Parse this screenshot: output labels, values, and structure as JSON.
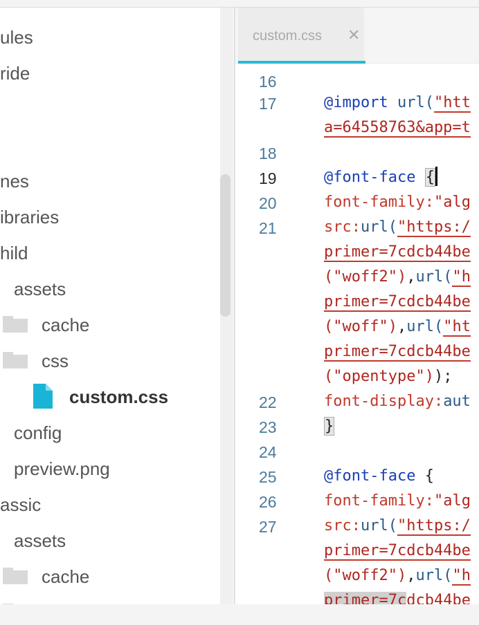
{
  "sidebar": {
    "items": [
      {
        "label": "ules"
      },
      {
        "label": "ride"
      },
      {
        "label": "nes"
      },
      {
        "label": "ibraries"
      },
      {
        "label": "hild"
      },
      {
        "label": "assets"
      },
      {
        "label": "cache"
      },
      {
        "label": "css"
      },
      {
        "label": "custom.css"
      },
      {
        "label": "config"
      },
      {
        "label": "preview.png"
      },
      {
        "label": "assic"
      },
      {
        "label": "assets"
      },
      {
        "label": "cache"
      }
    ]
  },
  "editor": {
    "tab": {
      "label": "custom.css",
      "close": "✕"
    },
    "line_numbers": [
      "16",
      "17",
      "18",
      "19",
      "20",
      "21",
      "22",
      "23",
      "24",
      "25",
      "26",
      "27"
    ],
    "lines": {
      "l17a_kw": "@import",
      "l17a_fn": "url(",
      "l17a_str": "\"htt",
      "l17b": "a=64558763&app=t",
      "l19_kw": "@font-face",
      "l19_brace": "{",
      "l20_prop": "font-family:",
      "l20_str": "\"alg",
      "l21a_prop": "src:",
      "l21a_fn": "url(",
      "l21a_str": "\"https:/",
      "l21b": "primer=7cdcb44be",
      "l21c_str1": "(\"woff2\")",
      "l21c_pn": ",",
      "l21c_fn": "url(",
      "l21c_str2": "\"h",
      "l21d": "primer=7cdcb44be",
      "l21e_str1": "(\"woff\")",
      "l21e_pn": ",",
      "l21e_fn": "url(",
      "l21e_str2": "\"ht",
      "l21f": "primer=7cdcb44be",
      "l21g_str": "(\"opentype\")",
      "l21g_pn": ");",
      "l22_prop": "font-display:",
      "l22_val": "aut",
      "l23": "}",
      "l25_kw": "@font-face",
      "l25_brace": " {",
      "l26_prop": "font-family:",
      "l26_str": "\"alg",
      "l27a_prop": "src:",
      "l27a_fn": "url(",
      "l27a_str": "\"https:/",
      "l27b": "primer=7cdcb44be",
      "l27c_str1": "(\"woff2\")",
      "l27c_pn": ",",
      "l27c_fn": "url(",
      "l27c_str2": "\"h",
      "l27d_sel": "primer=7c",
      "l27d_rest": "dcb44be"
    }
  },
  "colors": {
    "accent": "#27b8d4",
    "keyword": "#1a3fb3",
    "string": "#b0261f",
    "property": "#c0392b",
    "line_number": "#4a7a9a"
  }
}
